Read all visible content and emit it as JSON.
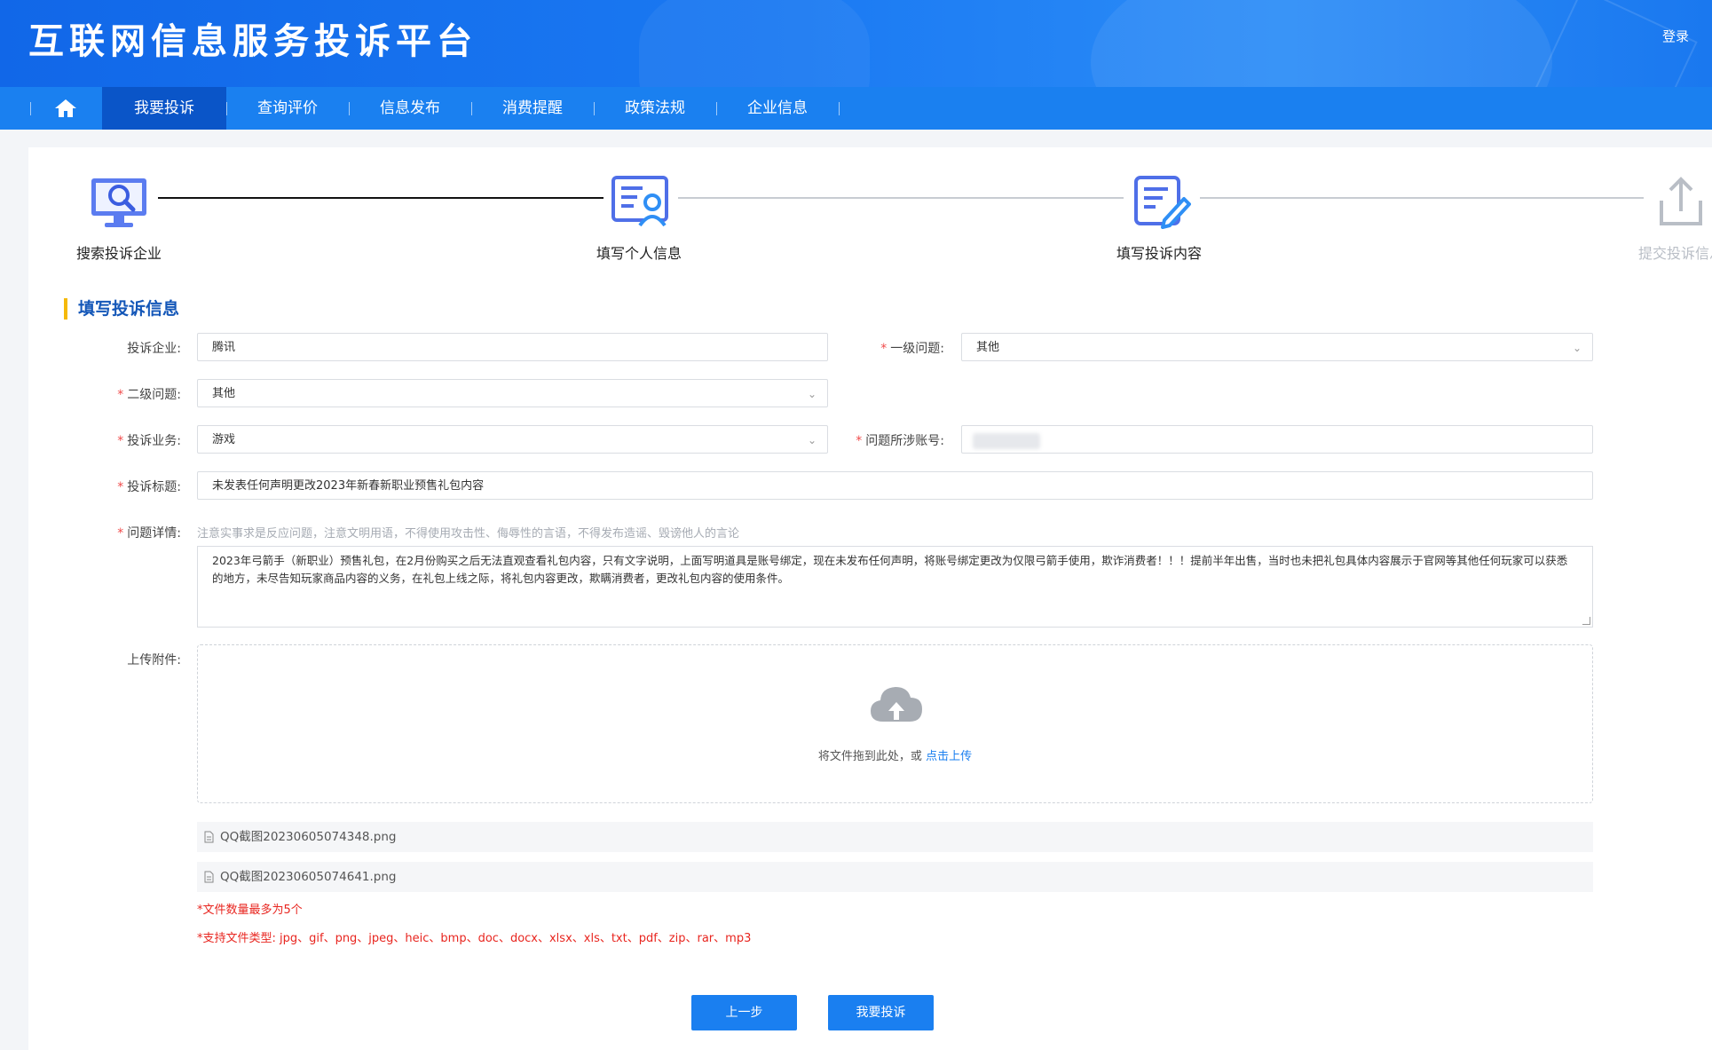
{
  "header": {
    "title": "互联网信息服务投诉平台",
    "login": "登录"
  },
  "nav": {
    "items": [
      {
        "label": "我要投诉"
      },
      {
        "label": "查询评价"
      },
      {
        "label": "信息发布"
      },
      {
        "label": "消费提醒"
      },
      {
        "label": "政策法规"
      },
      {
        "label": "企业信息"
      }
    ]
  },
  "steps": [
    {
      "label": "搜索投诉企业",
      "icon": "search-monitor-icon"
    },
    {
      "label": "填写个人信息",
      "icon": "person-form-icon"
    },
    {
      "label": "填写投诉内容",
      "icon": "edit-document-icon"
    },
    {
      "label": "提交投诉信息",
      "icon": "upload-share-icon"
    }
  ],
  "form": {
    "section_title": "填写投诉信息",
    "company": {
      "label": "投诉企业:",
      "value": "腾讯"
    },
    "level1": {
      "label": "一级问题:",
      "value": "其他"
    },
    "level2": {
      "label": "二级问题:",
      "value": "其他"
    },
    "business": {
      "label": "投诉业务:",
      "value": "游戏"
    },
    "account": {
      "label": "问题所涉账号:",
      "value": ""
    },
    "subject": {
      "label": "投诉标题:",
      "value": "未发表任何声明更改2023年新春新职业预售礼包内容"
    },
    "detail": {
      "label": "问题详情:",
      "hint": "注意实事求是反应问题，注意文明用语，不得使用攻击性、侮辱性的言语，不得发布造谣、毁谤他人的言论",
      "value": "2023年弓箭手（新职业）预售礼包，在2月份购买之后无法直观查看礼包内容，只有文字说明，上面写明道具是账号绑定，现在未发布任何声明，将账号绑定更改为仅限弓箭手使用，欺诈消费者！！！提前半年出售，当时也未把礼包具体内容展示于官网等其他任何玩家可以获悉的地方，未尽告知玩家商品内容的义务，在礼包上线之际，将礼包内容更改，欺瞒消费者，更改礼包内容的使用条件。"
    },
    "upload": {
      "label": "上传附件:",
      "text": "将文件拖到此处，或 ",
      "link": "点击上传"
    },
    "files": [
      "QQ截图20230605074348.png",
      "QQ截图20230605074641.png"
    ],
    "notes": [
      "*文件数量最多为5个",
      "*支持文件类型: jpg、gif、png、jpeg、heic、bmp、doc、docx、xlsx、xls、txt、pdf、zip、rar、mp3"
    ]
  },
  "buttons": {
    "prev": "上一步",
    "submit": "我要投诉"
  },
  "colors": {
    "primary": "#1a7ff0",
    "nav_active": "#0a55c8",
    "accent": "#f5b90a",
    "required": "#f04a4a"
  }
}
